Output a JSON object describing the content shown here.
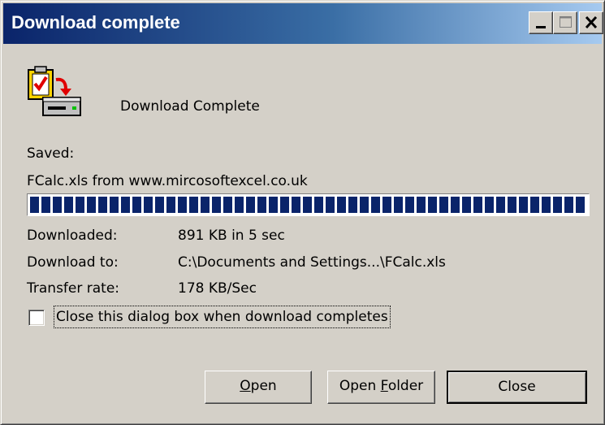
{
  "window": {
    "title": "Download complete",
    "controls": [
      "minimize-icon",
      "maximize-icon",
      "close-icon"
    ]
  },
  "header": {
    "icon": "download-complete-icon",
    "heading": "Download Complete"
  },
  "details": {
    "saved_label": "Saved:",
    "file_source": "FCalc.xls from www.mircosoftexcel.co.uk",
    "progress_percent": 100,
    "downloaded_label": "Downloaded:",
    "downloaded_value": "891 KB in 5 sec",
    "download_to_label": "Download to:",
    "download_to_value": "C:\\Documents and Settings...\\FCalc.xls",
    "transfer_rate_label": "Transfer rate:",
    "transfer_rate_value": "178 KB/Sec"
  },
  "options": {
    "close_when_done_label": "Close this dialog box when download completes",
    "close_when_done_checked": false
  },
  "buttons": {
    "open": {
      "underlined": "O",
      "rest": "pen"
    },
    "open_folder": {
      "before": "Open ",
      "underlined": "F",
      "rest": "older"
    },
    "close": "Close"
  },
  "colors": {
    "title_start": "#0a246a",
    "title_end": "#a6caf0",
    "face": "#d4d0c8",
    "progress": "#0a246a"
  }
}
